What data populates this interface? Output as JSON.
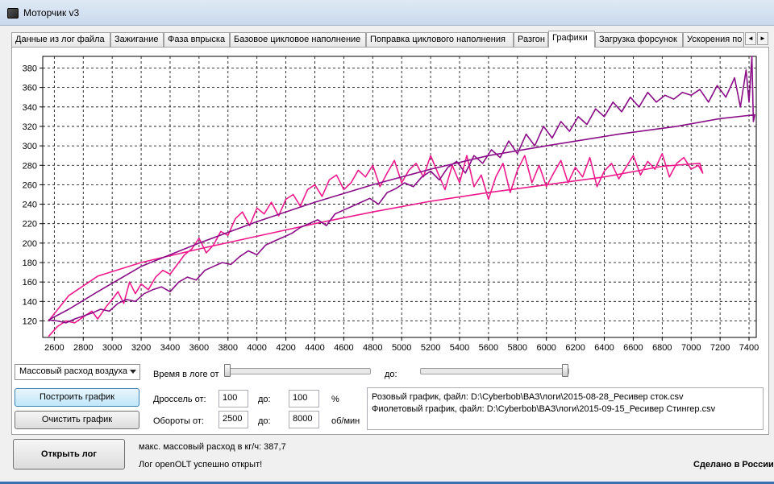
{
  "window": {
    "title": "Моторчик v3"
  },
  "tabs": [
    {
      "label": "Данные из лог файла",
      "active": false
    },
    {
      "label": "Зажигание",
      "active": false
    },
    {
      "label": "Фаза впрыска",
      "active": false
    },
    {
      "label": "Базовое цикловое наполнение",
      "active": false
    },
    {
      "label": "Поправка циклового наполнения",
      "active": false
    },
    {
      "label": "Разгон",
      "active": false
    },
    {
      "label": "Графики",
      "active": true
    },
    {
      "label": "Загрузка форсунок",
      "active": false
    },
    {
      "label": "Ускорения по",
      "active": false
    }
  ],
  "tab_scroll": {
    "left_icon": "◄",
    "right_icon": "►"
  },
  "chart_data": {
    "type": "line",
    "xlim": [
      2520,
      7450
    ],
    "ylim": [
      103,
      392
    ],
    "x_ticks": [
      2600,
      2800,
      3000,
      3200,
      3400,
      3600,
      3800,
      4000,
      4200,
      4400,
      4600,
      4800,
      5000,
      5200,
      5400,
      5600,
      5800,
      6000,
      6200,
      6400,
      6600,
      6800,
      7000,
      7200,
      7400
    ],
    "y_ticks": [
      120,
      140,
      160,
      180,
      200,
      220,
      240,
      260,
      280,
      300,
      320,
      340,
      360,
      380
    ],
    "grid": true,
    "series": [
      {
        "color": "#ee1a8c",
        "x": [
          2560,
          2620,
          2680,
          2740,
          2800,
          2860,
          2900,
          2960,
          3000,
          3040,
          3080,
          3120,
          3160,
          3200,
          3250,
          3300,
          3350,
          3400,
          3450,
          3500,
          3550,
          3600,
          3650,
          3700,
          3750,
          3800,
          3850,
          3900,
          3950,
          4000,
          4050,
          4100,
          4150,
          4200,
          4250,
          4300,
          4350,
          4400,
          4450,
          4500,
          4550,
          4600,
          4650,
          4700,
          4750,
          4800,
          4850,
          4900,
          4950,
          5000,
          5050,
          5100,
          5150,
          5200,
          5250,
          5300,
          5350,
          5400,
          5450,
          5500,
          5550,
          5600,
          5650,
          5700,
          5750,
          5800,
          5850,
          5900,
          5950,
          6000,
          6050,
          6100,
          6150,
          6200,
          6250,
          6300,
          6350,
          6400,
          6450,
          6500,
          6550,
          6600,
          6650,
          6700,
          6750,
          6800,
          6850,
          6900,
          6950,
          7000,
          7050,
          7080,
          7060,
          6800,
          6400,
          6000,
          5600,
          5200,
          4800,
          4400,
          4000,
          3600,
          3200,
          2900,
          2700,
          2560
        ],
        "y": [
          104,
          114,
          120,
          118,
          124,
          130,
          122,
          135,
          142,
          150,
          138,
          160,
          148,
          158,
          152,
          165,
          172,
          168,
          178,
          188,
          194,
          205,
          190,
          198,
          212,
          208,
          225,
          232,
          218,
          236,
          230,
          242,
          228,
          245,
          250,
          238,
          255,
          260,
          248,
          265,
          270,
          255,
          262,
          275,
          268,
          280,
          258,
          272,
          285,
          262,
          275,
          282,
          268,
          290,
          272,
          255,
          280,
          262,
          290,
          258,
          270,
          245,
          268,
          282,
          252,
          275,
          290,
          262,
          280,
          258,
          272,
          285,
          262,
          278,
          268,
          288,
          258,
          274,
          282,
          266,
          278,
          290,
          270,
          284,
          276,
          292,
          268,
          282,
          288,
          276,
          280,
          272,
          282,
          279,
          268,
          260,
          252,
          243,
          232,
          220,
          207,
          194,
          180,
          166,
          146,
          120
        ]
      },
      {
        "color": "#8a0c86",
        "x": [
          2560,
          2620,
          2680,
          2740,
          2800,
          2860,
          2920,
          2980,
          3040,
          3100,
          3160,
          3220,
          3280,
          3340,
          3400,
          3460,
          3520,
          3580,
          3640,
          3700,
          3760,
          3820,
          3880,
          3940,
          4000,
          4060,
          4120,
          4180,
          4240,
          4300,
          4360,
          4420,
          4480,
          4540,
          4600,
          4660,
          4720,
          4780,
          4840,
          4900,
          4960,
          5020,
          5080,
          5140,
          5200,
          5260,
          5320,
          5380,
          5440,
          5500,
          5560,
          5620,
          5680,
          5740,
          5800,
          5860,
          5920,
          5980,
          6040,
          6100,
          6160,
          6220,
          6280,
          6340,
          6400,
          6460,
          6520,
          6580,
          6640,
          6700,
          6760,
          6820,
          6880,
          6940,
          7000,
          7060,
          7120,
          7180,
          7240,
          7300,
          7340,
          7380,
          7400,
          7420,
          7430,
          7440,
          7200,
          6900,
          6500,
          6000,
          5600,
          5200,
          4800,
          4400,
          4000,
          3600,
          3200,
          2900,
          2700,
          2560
        ],
        "y": [
          121,
          120,
          118,
          122,
          125,
          128,
          132,
          130,
          138,
          142,
          140,
          148,
          152,
          155,
          150,
          160,
          165,
          162,
          172,
          176,
          180,
          178,
          186,
          192,
          188,
          198,
          202,
          206,
          210,
          216,
          220,
          224,
          218,
          230,
          234,
          238,
          242,
          246,
          240,
          252,
          256,
          262,
          258,
          268,
          274,
          265,
          278,
          284,
          272,
          290,
          282,
          296,
          288,
          305,
          292,
          312,
          300,
          320,
          308,
          325,
          315,
          330,
          322,
          338,
          330,
          345,
          335,
          350,
          340,
          355,
          345,
          352,
          348,
          355,
          352,
          358,
          345,
          362,
          350,
          370,
          340,
          378,
          345,
          392,
          325,
          332,
          328,
          320,
          312,
          300,
          290,
          276,
          260,
          242,
          222,
          200,
          176,
          150,
          132,
          121
        ]
      }
    ]
  },
  "controls": {
    "param_select": {
      "value": "Массовый расход воздуха"
    },
    "build_button": "Построить график",
    "clear_button": "Очистить график",
    "time_label": "Время в логе от",
    "time_to_label": "до:",
    "throttle_label": "Дроссель от:",
    "throttle_from": "100",
    "throttle_to_label": "до:",
    "throttle_to": "100",
    "throttle_unit": "%",
    "rpm_label": "Обороты от:",
    "rpm_from": "2500",
    "rpm_to_label": "до:",
    "rpm_to": "8000",
    "rpm_unit": "об/мин"
  },
  "info": {
    "line1": "Розовый график, файл: D:\\Cyberbob\\ВАЗ\\логи\\2015-08-28_Ресивер сток.csv",
    "line2": "Фиолетовый график, файл: D:\\Cyberbob\\ВАЗ\\логи\\2015-09-15_Ресивер Стингер.csv"
  },
  "footer": {
    "open_button": "Открыть лог",
    "max_airflow": "макс. массовый расход в кг/ч: 387,7",
    "status": "Лог openOLT успешно открыт!",
    "made_in": "Сделано в России"
  }
}
